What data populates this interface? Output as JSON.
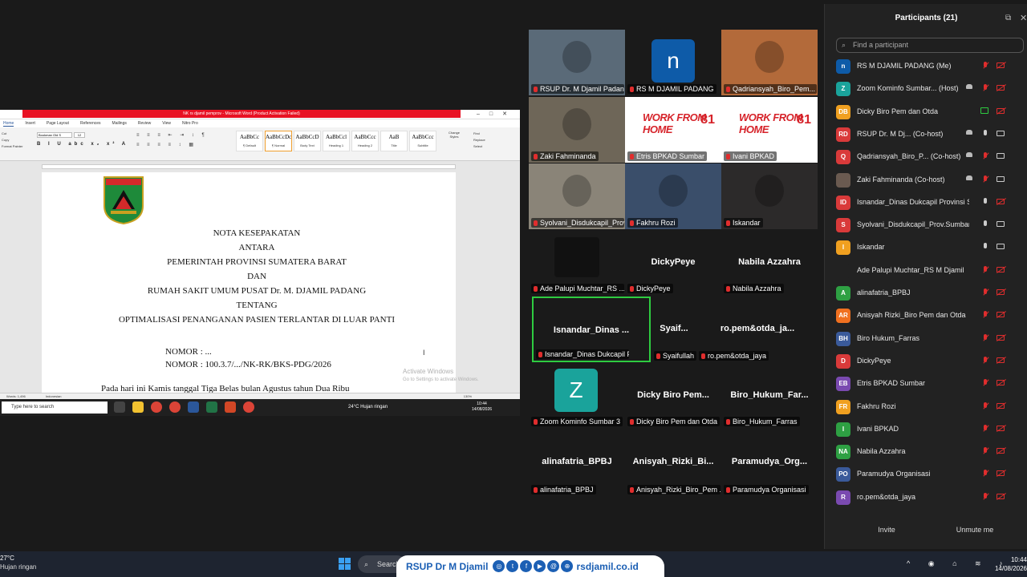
{
  "word": {
    "title": "NK rs djamil pemprov - Microsoft Word (Product Activation Failed)",
    "tabs": [
      "Home",
      "Insert",
      "Page Layout",
      "References",
      "Mailings",
      "Review",
      "View",
      "Nitro Pro"
    ],
    "clipboard": [
      "Cut",
      "Copy",
      "Format Painter"
    ],
    "font_name": "Bookman Old S",
    "font_size": "12",
    "group_labels": {
      "clipboard": "board",
      "font": "Font",
      "paragraph": "Paragraph",
      "styles": "Styles",
      "editing": "Editing"
    },
    "styles": [
      {
        "preview": "AaBbCc",
        "name": "¶ Default"
      },
      {
        "preview": "AaBbCcDc",
        "name": "¶ Normal"
      },
      {
        "preview": "AaBbCcD",
        "name": "Body Text"
      },
      {
        "preview": "AaBbCcl",
        "name": "Heading 1"
      },
      {
        "preview": "AaBbCcc",
        "name": "Heading 2"
      },
      {
        "preview": "AaB",
        "name": "Title"
      },
      {
        "preview": "AaBbCcc",
        "name": "Subtitle"
      }
    ],
    "change_styles": "Change Styles",
    "editing": [
      "Find",
      "Replace",
      "Select"
    ],
    "logo_text": "SUMATERA BARAT",
    "doc_lines": [
      "NOTA KESEPAKATAN",
      "ANTARA",
      "PEMERINTAH PROVINSI SUMATERA BARAT",
      "DAN",
      "RUMAH SAKIT UMUM PUSAT Dr. M. DJAMIL PADANG",
      "TENTANG",
      "OPTIMALISASI PENANGANAN PASIEN TERLANTAR DI LUAR PANTI"
    ],
    "nomor1": "NOMOR : ...",
    "nomor2": "NOMOR : 100.3.7/.../NK-RK/BKS-PDG/2026",
    "paragraph_start": "Pada hari ini Kamis tanggal Tiga Belas bulan Agustus   tahun Dua Ribu",
    "watermark": "Activate Windows",
    "watermark_sub": "Go to Settings to activate Windows.",
    "status_words": "Words: 1,496",
    "status_lang": "Indonesian",
    "status_zoom": "130%",
    "inner_search": "Type here to search",
    "inner_weather": "24°C  Hujan ringan",
    "inner_time": "10:44",
    "inner_date": "14/08/2026"
  },
  "gallery": {
    "video_tiles": [
      {
        "label": "RSUP Dr. M Djamil Padang",
        "bg": "#5a6a78"
      },
      {
        "label": "RS M DJAMIL PADANG",
        "avatar": "n",
        "avatar_color": "#0e5ba8",
        "bg": "#1a1a1a"
      },
      {
        "label": "Qadriansyah_Biro_Pem...",
        "bg": "#b36a3a"
      },
      {
        "label": "Zaki Fahminanda",
        "bg": "#6e6658"
      },
      {
        "label": "Etris BPKAD Sumbar",
        "wfh": "WORK FROM HOME",
        "wfh_num": "81"
      },
      {
        "label": "Ivani BPKAD",
        "wfh": "WORK FROM HOME",
        "wfh_num": "81"
      },
      {
        "label": "Syolvani_Disdukcapil_Prov...",
        "bg": "#8a8478"
      },
      {
        "label": "Fakhru Rozi",
        "bg": "#3a4e6a"
      },
      {
        "label": "Iskandar",
        "bg": "#2c2a2a"
      }
    ],
    "name_tiles": [
      {
        "label": "Ade Palupi Muchtar_RS ...",
        "center": ""
      },
      {
        "label": "DickyPeye",
        "center": "DickyPeye"
      },
      {
        "label": "Nabila Azzahra",
        "center": "Nabila Azzahra"
      },
      {
        "label": "Isnandar_Dinas Dukcapil Provinsi ...",
        "center": "Isnandar_Dinas ..."
      },
      {
        "label": "Syaifullah",
        "center": "Syaif..."
      },
      {
        "label": "ro.pem&otda_jaya",
        "center": "ro.pem&otda_ja..."
      },
      {
        "label": "Zoom Kominfo Sumbar 3",
        "avatar": "Z",
        "avatar_color": "#1aa39b"
      },
      {
        "label": "Dicky Biro Pem dan Otda",
        "center": "Dicky Biro Pem..."
      },
      {
        "label": "Biro_Hukum_Farras",
        "center": "Biro_Hukum_Far..."
      },
      {
        "label": "alinafatria_BPBJ",
        "center": "alinafatria_BPBJ"
      },
      {
        "label": "Anisyah_Rizki_Biro_Pem ...",
        "center": "Anisyah_Rizki_Bi..."
      },
      {
        "label": "Paramudya Organisasi",
        "center": "Paramudya_Org..."
      }
    ]
  },
  "panel": {
    "title": "Participants (21)",
    "search_placeholder": "Find a participant",
    "invite": "Invite",
    "unmute": "Unmute me",
    "participants": [
      {
        "initials": "n",
        "color": "#0e5ba8",
        "name": "RS M DJAMIL PADANG (Me)",
        "cam": "off"
      },
      {
        "initials": "Z",
        "color": "#1aa39b",
        "name": "Zoom Kominfo Sumbar... (Host)",
        "cam": "off",
        "extra": true
      },
      {
        "initials": "DB",
        "color": "#f0a020",
        "name": "Dicky Biro Pem dan Otda",
        "cam": "off",
        "share": true
      },
      {
        "initials": "RD",
        "color": "#d93a3a",
        "name": "RSUP Dr. M Dj... (Co-host)",
        "cam": "on",
        "extra": true,
        "mic": "on"
      },
      {
        "initials": "Q",
        "color": "#d93a3a",
        "name": "Qadriansyah_Biro_P... (Co-host)",
        "cam": "on",
        "extra": true
      },
      {
        "initials": "",
        "color": "#6a5a50",
        "name": "Zaki Fahminanda (Co-host)",
        "cam": "on",
        "extra": true
      },
      {
        "initials": "ID",
        "color": "#d93a3a",
        "name": "Isnandar_Dinas Dukcapil Provinsi S...",
        "cam": "off",
        "mic": "on"
      },
      {
        "initials": "S",
        "color": "#d93a3a",
        "name": "Syolvani_Disdukcapil_Prov.Sumbar",
        "cam": "on",
        "mic": "on"
      },
      {
        "initials": "I",
        "color": "#f0a020",
        "name": "Iskandar",
        "cam": "on",
        "mic": "on"
      },
      {
        "initials": "",
        "color": "#222222",
        "name": "Ade Palupi Muchtar_RS M Djamil",
        "cam": "off"
      },
      {
        "initials": "A",
        "color": "#2ea043",
        "name": "alinafatria_BPBJ",
        "cam": "off"
      },
      {
        "initials": "AR",
        "color": "#f07020",
        "name": "Anisyah Rizki_Biro Pem dan Otda",
        "cam": "off"
      },
      {
        "initials": "BH",
        "color": "#3a5a9a",
        "name": "Biro Hukum_Farras",
        "cam": "off"
      },
      {
        "initials": "D",
        "color": "#d93a3a",
        "name": "DickyPeye",
        "cam": "off"
      },
      {
        "initials": "EB",
        "color": "#7a4ab0",
        "name": "Etris BPKAD Sumbar",
        "cam": "off"
      },
      {
        "initials": "FR",
        "color": "#f0a020",
        "name": "Fakhru Rozi",
        "cam": "off"
      },
      {
        "initials": "I",
        "color": "#2ea043",
        "name": "Ivani BPKAD",
        "cam": "off"
      },
      {
        "initials": "NA",
        "color": "#2ea043",
        "name": "Nabila Azzahra",
        "cam": "off"
      },
      {
        "initials": "PO",
        "color": "#3a5a9a",
        "name": "Paramudya Organisasi",
        "cam": "off"
      },
      {
        "initials": "R",
        "color": "#7a4ab0",
        "name": "ro.pem&otda_jaya",
        "cam": "off"
      }
    ]
  },
  "taskbar": {
    "temp": "27°C",
    "weather": "Hujan ringan",
    "search": "Search",
    "time": "10:44",
    "date": "14/08/2026"
  },
  "banner": {
    "name": "RSUP Dr M Djamil",
    "website": "rsdjamil.co.id",
    "social_icons": [
      "instagram-icon",
      "twitter-icon",
      "facebook-icon",
      "youtube-icon",
      "threads-icon",
      "globe-icon"
    ]
  }
}
